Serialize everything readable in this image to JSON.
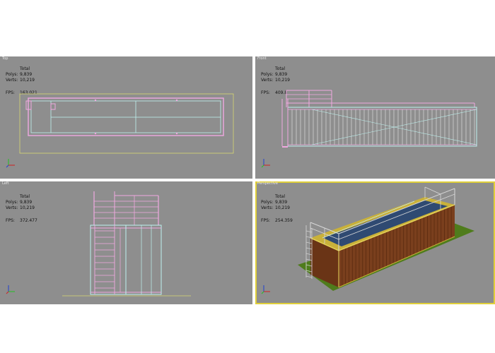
{
  "viewports": [
    {
      "label": "Top",
      "active": false,
      "stats": {
        "header": "Total",
        "polys_label": "Polys:",
        "polys": "9,839",
        "verts_label": "Verts:",
        "verts": "10,219"
      },
      "fps": {
        "label": "FPS:",
        "value": "163.021"
      }
    },
    {
      "label": "Front",
      "active": false,
      "stats": {
        "header": "Total",
        "polys_label": "Polys:",
        "polys": "9,839",
        "verts_label": "Verts:",
        "verts": "10,219"
      },
      "fps": {
        "label": "FPS:",
        "value": "409.8"
      }
    },
    {
      "label": "Left",
      "active": false,
      "stats": {
        "header": "Total",
        "polys_label": "Polys:",
        "polys": "9,839",
        "verts_label": "Verts:",
        "verts": "10,219"
      },
      "fps": {
        "label": "FPS:",
        "value": "372.477"
      }
    },
    {
      "label": "Perspective",
      "active": true,
      "stats": {
        "header": "Total",
        "polys_label": "Polys:",
        "polys": "9,839",
        "verts_label": "Verts:",
        "verts": "10,219"
      },
      "fps": {
        "label": "FPS:",
        "value": "254.359"
      }
    }
  ],
  "colors": {
    "viewport_bg": "#8e8e8e",
    "active_border": "#e0cf3a",
    "wire_pink": "#f0a8e0",
    "wire_cyan": "#bff3f0",
    "grid_yellow": "#d8d870",
    "container_brown": "#7a3f1d",
    "container_trim": "#c9b13a",
    "pool_water": "#2f4a72",
    "grass": "#4f7c1c"
  },
  "icons": {
    "axis": "axis-tripod-icon"
  }
}
